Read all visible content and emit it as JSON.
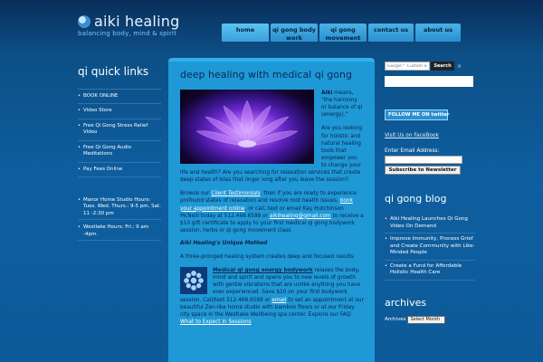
{
  "header": {
    "title": "aiki healing",
    "tagline": "balancing body, mind & spirit"
  },
  "nav": [
    {
      "label": "home"
    },
    {
      "label": "qi gong body work"
    },
    {
      "label": "qi gong movement"
    },
    {
      "label": "contact us"
    },
    {
      "label": "about us"
    }
  ],
  "left": {
    "title": "qi quick links",
    "links": [
      "BOOK ONLINE",
      "Video Store",
      "Free Qi Gong Stress Relief Video",
      "Free Qi Gong Audio Meditations",
      "Pay Fees Online"
    ],
    "hours": [
      "Manor Home Studio Hours: Tues. Wed. Thurs.: 9-5 pm, Sat. 11 -2:30 pm",
      "Westlake Hours: Fri.: 9 am -4pm."
    ]
  },
  "main": {
    "title": "deep healing with medical qi gong",
    "intro_bold": "Aiki",
    "intro_rest": " means, \"the harmony or balance of qi (energy).\"",
    "question": "Are you looking for holistic and natural healing tools that empower you to change your life and health? Are you searching for relaxation services that create deep states of bliss that linger long after you leave the session?",
    "browse_1": "Browse our ",
    "browse_link1": "Client Testimonials",
    "browse_2": ", then if you are ready to experience profound states of relaxation and resolve root health issues, ",
    "browse_link2": "book your appointment online",
    "browse_3": ", or call, text or email Kay Hutchinson McNeill today at 512.468.6588 or ",
    "browse_link3": "aikihealing@gmail.com",
    "browse_4": " to receive a $10 gift certificate to apply to your first medical qi gong bodywork session, herbs or qi gong movement class.",
    "method_title": "Aiki Healing's Unique Method",
    "method_intro": "A three-pronged healing system creates deep and focused results:",
    "bodywork_link": "Medical qi gong energy bodywork",
    "bodywork_1": " relaxes the body, mind and spirit and opens you to new levels of growth with gentle vibrations that are unlike anything you have ever experienced. Save $10 on your first bodywork session. Call/text 512.468.6588 or ",
    "bodywork_link2": "email",
    "bodywork_2": " to set an appointment at our beautiful Zen-like home studio with bamboo floors or at our Friday city space in the Westlake Wellbeing spa center. Explore our FAQ: ",
    "bodywork_link3": "What to Expect in Sessions"
  },
  "right": {
    "search_placeholder": "Google™ Custom Search",
    "search_button": "Search",
    "search_close": "×",
    "twitter_label": "FOLLOW ME ON twitter",
    "facebook_link": "Visit Us on FaceBook",
    "email_label": "Enter Email Address:",
    "subscribe_button": "Subscribe to Newsletter",
    "blog_title": "qi gong blog",
    "blog_items": [
      "Aiki Healing Launches Qi Gong Video On Demand",
      "Improve Immunity, Process Grief and Create Community with Like-Minded People",
      "Create a Fund for Affordable Holistic Health Care"
    ],
    "archives_title": "archives",
    "archives_label": "Archives",
    "archives_selected": "Select Month"
  }
}
